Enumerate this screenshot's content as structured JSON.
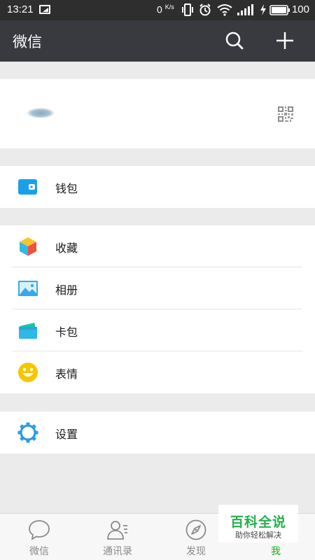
{
  "status_bar": {
    "time": "13:21",
    "net_speed": "0",
    "net_speed_unit": "K/s",
    "battery_percent": "100"
  },
  "app_bar": {
    "title": "微信",
    "search_icon": "search-icon",
    "add_icon": "plus-icon"
  },
  "profile": {
    "qr_icon": "qr-code-icon"
  },
  "menu": {
    "wallet": {
      "label": "钱包",
      "icon": "wallet-icon",
      "color": "#1aa0ea"
    },
    "favorites": {
      "label": "收藏",
      "icon": "cube-icon"
    },
    "album": {
      "label": "相册",
      "icon": "album-icon",
      "color": "#39a9ea"
    },
    "card_bag": {
      "label": "卡包",
      "icon": "card-bag-icon"
    },
    "emoji": {
      "label": "表情",
      "icon": "smiley-icon",
      "color": "#f6c700"
    },
    "settings": {
      "label": "设置",
      "icon": "gear-icon",
      "color": "#2e9be6"
    }
  },
  "tabs": [
    {
      "label": "微信",
      "icon": "chat-bubble-icon",
      "active": false
    },
    {
      "label": "通讯录",
      "icon": "contacts-icon",
      "active": false
    },
    {
      "label": "发现",
      "icon": "compass-icon",
      "active": false
    },
    {
      "label": "我",
      "icon": "me-icon",
      "active": true
    }
  ],
  "watermark": {
    "title": "百科全说",
    "subtitle": "助你轻松解决"
  },
  "colors": {
    "app_bar_bg": "#393a3f",
    "status_bar_bg": "#2e2e2e",
    "active_tab": "#1aad19",
    "page_bg": "#ebebeb"
  }
}
